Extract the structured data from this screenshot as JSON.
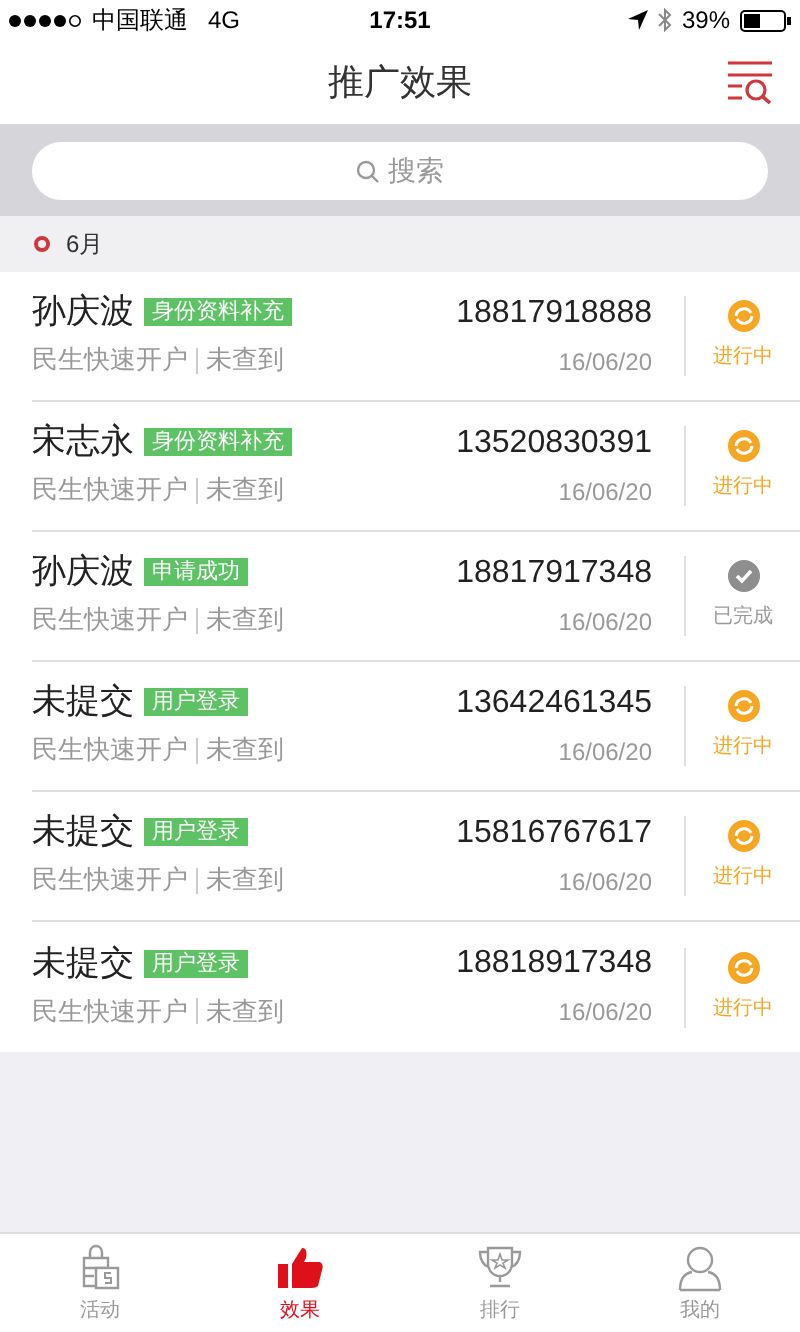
{
  "status_bar": {
    "carrier": "中国联通",
    "network": "4G",
    "time": "17:51",
    "battery": "39%"
  },
  "nav": {
    "title": "推广效果"
  },
  "search": {
    "placeholder": "搜索"
  },
  "section": {
    "label": "6月"
  },
  "rows": [
    {
      "name": "孙庆波",
      "tag": "身份资料补充",
      "phone": "18817918888",
      "product": "民生快速开户",
      "result": "未查到",
      "date": "16/06/20",
      "kind": "in_progress",
      "status": "进行中"
    },
    {
      "name": "宋志永",
      "tag": "身份资料补充",
      "phone": "13520830391",
      "product": "民生快速开户",
      "result": "未查到",
      "date": "16/06/20",
      "kind": "in_progress",
      "status": "进行中"
    },
    {
      "name": "孙庆波",
      "tag": "申请成功",
      "phone": "18817917348",
      "product": "民生快速开户",
      "result": "未查到",
      "date": "16/06/20",
      "kind": "done",
      "status": "已完成"
    },
    {
      "name": "未提交",
      "tag": "用户登录",
      "phone": "13642461345",
      "product": "民生快速开户",
      "result": "未查到",
      "date": "16/06/20",
      "kind": "in_progress",
      "status": "进行中"
    },
    {
      "name": "未提交",
      "tag": "用户登录",
      "phone": "15816767617",
      "product": "民生快速开户",
      "result": "未查到",
      "date": "16/06/20",
      "kind": "in_progress",
      "status": "进行中"
    },
    {
      "name": "未提交",
      "tag": "用户登录",
      "phone": "18818917348",
      "product": "民生快速开户",
      "result": "未查到",
      "date": "16/06/20",
      "kind": "in_progress",
      "status": "进行中"
    }
  ],
  "tabs": [
    {
      "label": "活动",
      "kind": "activity",
      "selected": false
    },
    {
      "label": "效果",
      "kind": "effect",
      "selected": true
    },
    {
      "label": "排行",
      "kind": "ranking",
      "selected": false
    },
    {
      "label": "我的",
      "kind": "mine",
      "selected": false
    }
  ]
}
